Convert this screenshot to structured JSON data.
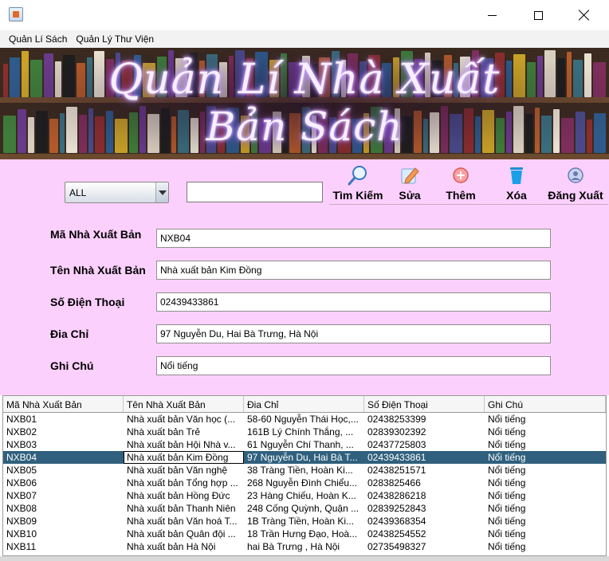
{
  "window": {
    "minimize_icon": "minimize-icon",
    "maximize_icon": "maximize-icon",
    "close_icon": "close-icon"
  },
  "menu": {
    "items": [
      "Quản Lí Sách",
      "Quản Lý Thư Viện"
    ]
  },
  "banner": {
    "line1": "Quản Lí Nhà Xuất",
    "line2": "Bản Sách"
  },
  "filter": {
    "selected": "ALL",
    "search_value": ""
  },
  "toolbar": {
    "search": "Tìm Kiếm",
    "edit": "Sửa",
    "add": "Thêm",
    "delete": "Xóa",
    "logout": "Đăng Xuất"
  },
  "form": {
    "ma_label": "Mã Nhà Xuất Bản",
    "ma_value": "NXB04",
    "ten_label": "Tên Nhà Xuất Bản",
    "ten_value": "Nhà xuất bản Kim Đồng",
    "sdt_label": "Số Điện Thoại",
    "sdt_value": "02439433861",
    "diachi_label": "Đia Chỉ",
    "diachi_value": "97 Nguyễn Du, Hai Bà Trưng, Hà Nội",
    "ghichu_label": "Ghi Chú",
    "ghichu_value": "Nổi tiếng"
  },
  "table": {
    "headers": [
      "Mã Nhà Xuất Bản",
      "Tên Nhà Xuất Bản",
      "Đia Chỉ",
      "Số Điện Thoại",
      "Ghi Chú"
    ],
    "selected_row": 3,
    "rows": [
      [
        "NXB01",
        "Nhà xuất bản Văn học (...",
        "58-60 Nguyễn Thái Học,...",
        "02438253399",
        "Nổi tiếng"
      ],
      [
        "NXB02",
        "Nhà xuất bản Trẻ",
        "161B Lý Chính Thắng, ...",
        "02839302392",
        "Nổi tiếng"
      ],
      [
        "NXB03",
        "Nhà xuất bản Hội Nhà v...",
        "61 Nguyễn Chí Thanh, ...",
        "02437725803",
        "Nổi tiếng"
      ],
      [
        "NXB04",
        "Nhà xuất bản Kim Đồng",
        "97 Nguyễn Du, Hai Bà T...",
        "02439433861",
        "Nổi tiếng"
      ],
      [
        "NXB05",
        "Nhà xuất bản Văn nghệ",
        "38 Tràng Tiền, Hoàn Ki...",
        "02438251571",
        "Nổi tiếng"
      ],
      [
        "NXB06",
        "Nhà xuất bản Tổng hợp ...",
        "268 Nguyễn Đình Chiểu...",
        "0283825466",
        "Nổi tiếng"
      ],
      [
        "NXB07",
        "Nhà xuất bản Hồng Đức",
        "23 Hàng Chiếu, Hoàn K...",
        "02438286218",
        "Nổi tiếng"
      ],
      [
        "NXB08",
        "Nhà xuất bản Thanh Niên",
        "248 Cống Quỳnh, Quận ...",
        "02839252843",
        "Nổi tiếng"
      ],
      [
        "NXB09",
        "Nhà xuất bản Văn hoá T...",
        "1B Tràng Tiền, Hoàn Ki...",
        "02439368354",
        "Nổi tiếng"
      ],
      [
        "NXB10",
        "Nhà xuất bản Quân đội ...",
        "18 Trần Hưng Đạo, Hoà...",
        "02438254552",
        "Nổi tiếng"
      ],
      [
        "NXB11",
        "Nhà xuất bản Hà Nội",
        "hai Bà Trưng , Hà Nội",
        "02735498327",
        "Nổi tiếng"
      ]
    ]
  },
  "colors": {
    "panel": "#fcd0fc",
    "selected_row": "#30607e"
  }
}
